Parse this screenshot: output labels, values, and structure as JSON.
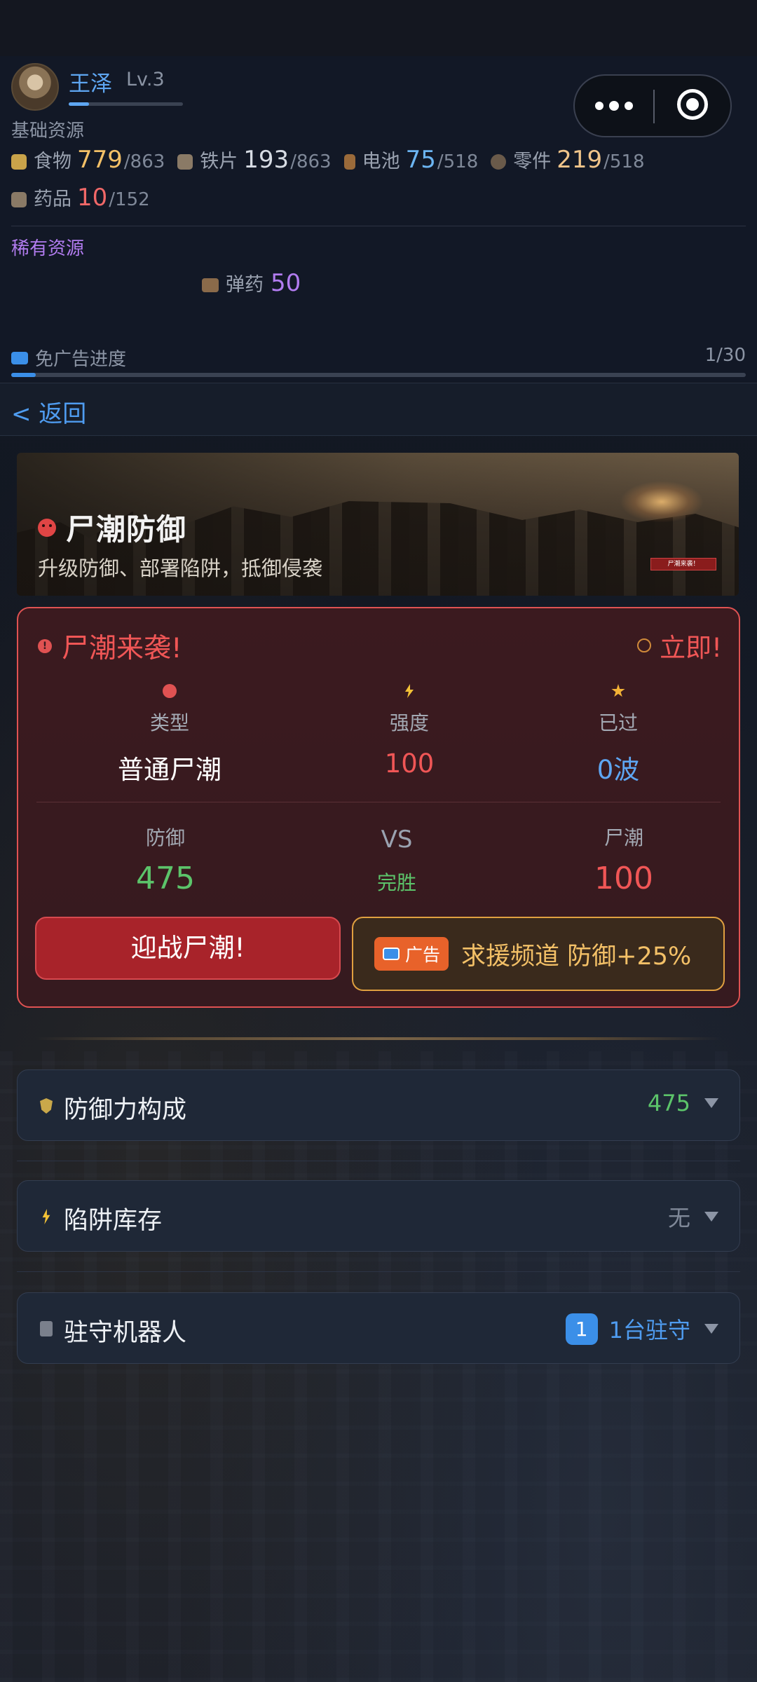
{
  "player": {
    "name": "王泽",
    "level": "Lv.3",
    "xp_fraction": 0.18
  },
  "resources": {
    "basic_label": "基础资源",
    "items": [
      {
        "name": "食物",
        "value": "779",
        "max": "/863",
        "icon": "food-can-icon",
        "color": "#f3c067",
        "icon_color": "#c9a34a"
      },
      {
        "name": "铁片",
        "value": "193",
        "max": "/863",
        "icon": "iron-plates-icon",
        "color": "#d7dce4",
        "icon_color": "#8a7a66"
      },
      {
        "name": "电池",
        "value": "75",
        "max": "/518",
        "icon": "battery-icon",
        "color": "#6cb5f2",
        "icon_color": "#9a6a3a"
      },
      {
        "name": "零件",
        "value": "219",
        "max": "/518",
        "icon": "parts-icon",
        "color": "#f0c48a",
        "icon_color": "#6a5a4a"
      },
      {
        "name": "药品",
        "value": "10",
        "max": "/152",
        "icon": "medicine-box-icon",
        "color": "#f06868",
        "icon_color": "#8a7a66"
      }
    ],
    "rare_label": "稀有资源",
    "rare": {
      "name": "弹药",
      "value": "50",
      "icon": "ammo-icon"
    }
  },
  "ad_progress": {
    "label": "免广告进度",
    "count": "1/30",
    "fraction": 0.0333
  },
  "nav": {
    "back_label": "< 返回"
  },
  "banner": {
    "title": "尸潮防御",
    "subtitle": "升级防御、部署陷阱，抵御侵袭",
    "tag": "尸潮来袭！"
  },
  "alert": {
    "title": "尸潮来袭!",
    "timing": "立即!",
    "stats": [
      {
        "label": "类型",
        "value": "普通尸潮",
        "icon": "skull-icon",
        "color": "#ffffff"
      },
      {
        "label": "强度",
        "value": "100",
        "icon": "lightning-icon",
        "color": "#f05656"
      },
      {
        "label": "已过",
        "value": "0波",
        "icon": "star-icon",
        "color": "#5ea6f2"
      }
    ],
    "defense": {
      "label": "防御",
      "value": "475"
    },
    "vs": "VS",
    "result": "完胜",
    "horde": {
      "label": "尸潮",
      "value": "100"
    },
    "fight_button": "迎战尸潮!",
    "help_button": {
      "ad_tag": "广告",
      "text": "求援频道 防御+25%"
    }
  },
  "sections": [
    {
      "title": "防御力构成",
      "value": "475",
      "value_color": "#5cc46a",
      "icon": "shield-icon"
    },
    {
      "title": "陷阱库存",
      "value": "无",
      "value_color": "#7f8898",
      "icon": "lightning-icon"
    },
    {
      "title": "驻守机器人",
      "badge": "1",
      "value": "1台驻守",
      "value_color": "#4f9cf0",
      "icon": "robot-icon"
    }
  ],
  "colors": {
    "accent_blue": "#4f9cf0",
    "danger_red": "#e05252",
    "gold": "#e0a040",
    "green": "#5cc46a",
    "purple": "#b27cf0"
  }
}
